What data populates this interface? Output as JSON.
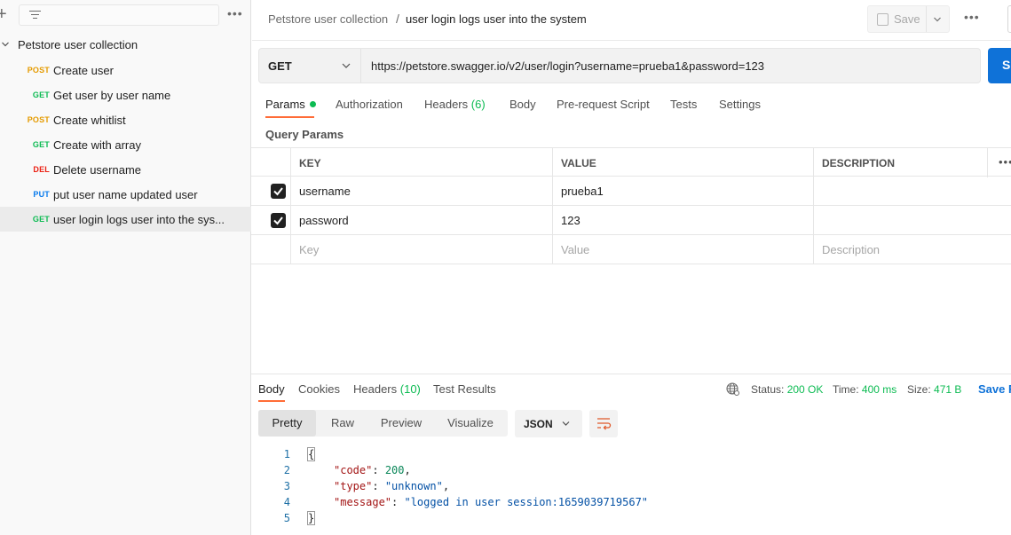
{
  "sidebar": {
    "more_label": "•••",
    "collection": {
      "name": "Petstore user collection"
    },
    "requests": [
      {
        "method": "POST",
        "name": "Create user",
        "color": "#e59b00",
        "active": false
      },
      {
        "method": "GET",
        "name": "Get user by user name",
        "color": "#0cbb52",
        "active": false
      },
      {
        "method": "POST",
        "name": "Create whitlist",
        "color": "#e59b00",
        "active": false
      },
      {
        "method": "GET",
        "name": "Create with array",
        "color": "#0cbb52",
        "active": false
      },
      {
        "method": "DEL",
        "name": "Delete username",
        "color": "#eb2013",
        "active": false
      },
      {
        "method": "PUT",
        "name": "put user name updated user",
        "color": "#097bed",
        "active": false
      },
      {
        "method": "GET",
        "name": "user login logs user into the sys...",
        "color": "#0cbb52",
        "active": true
      }
    ]
  },
  "header": {
    "breadcrumb_parent": "Petstore user collection",
    "breadcrumb_sep": "/",
    "breadcrumb_current": "user login logs user into the system",
    "save_label": "Save",
    "more_label": "•••"
  },
  "request": {
    "method": "GET",
    "url": "https://petstore.swagger.io/v2/user/login?username=prueba1&password=123",
    "send_label": "S",
    "tabs": {
      "params": "Params",
      "authorization": "Authorization",
      "headers": "Headers",
      "headers_count": "(6)",
      "body": "Body",
      "prerequest": "Pre-request Script",
      "tests": "Tests",
      "settings": "Settings"
    },
    "query_params_title": "Query Params",
    "table": {
      "headers": {
        "key": "KEY",
        "value": "VALUE",
        "description": "DESCRIPTION",
        "more": "•••"
      },
      "rows": [
        {
          "key": "username",
          "value": "prueba1",
          "description": "",
          "checked": true
        },
        {
          "key": "password",
          "value": "123",
          "description": "",
          "checked": true
        }
      ],
      "placeholder": {
        "key": "Key",
        "value": "Value",
        "description": "Description"
      }
    }
  },
  "response": {
    "tabs": {
      "body": "Body",
      "cookies": "Cookies",
      "headers": "Headers",
      "headers_count": "(10)",
      "test_results": "Test Results"
    },
    "status_label": "Status:",
    "status_value": "200 OK",
    "time_label": "Time:",
    "time_value": "400 ms",
    "size_label": "Size:",
    "size_value": "471 B",
    "save_label": "Save R",
    "views": {
      "pretty": "Pretty",
      "raw": "Raw",
      "preview": "Preview",
      "visualize": "Visualize"
    },
    "format": "JSON",
    "code": {
      "line_numbers": [
        "1",
        "2",
        "3",
        "4",
        "5"
      ],
      "open_brace": "{",
      "close_brace": "}",
      "entries": [
        {
          "key": "\"code\"",
          "sep": ": ",
          "value": "200",
          "comma": ","
        },
        {
          "key": "\"type\"",
          "sep": ": ",
          "value": "\"unknown\"",
          "comma": ","
        },
        {
          "key": "\"message\"",
          "sep": ": ",
          "value": "\"logged in user session:1659039719567\"",
          "comma": ""
        }
      ]
    }
  }
}
